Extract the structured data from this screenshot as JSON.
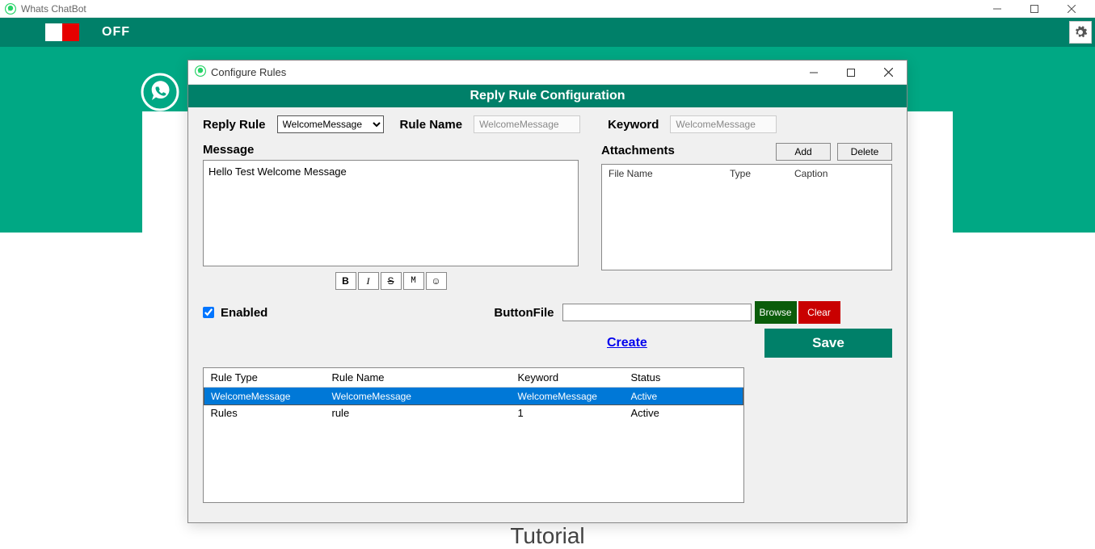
{
  "outer_title": "Whats ChatBot",
  "toggle_label": "OFF",
  "dialog": {
    "title": "Configure Rules",
    "header": "Reply Rule Configuration",
    "reply_rule_lbl": "Reply Rule",
    "reply_rule_value": "WelcomeMessage",
    "rule_name_lbl": "Rule Name",
    "rule_name_value": "WelcomeMessage",
    "keyword_lbl": "Keyword",
    "keyword_value": "WelcomeMessage",
    "message_lbl": "Message",
    "message_value": "Hello Test Welcome Message",
    "attachments_lbl": "Attachments",
    "add_btn": "Add",
    "delete_btn": "Delete",
    "att_cols": {
      "c1": "File Name",
      "c2": "Type",
      "c3": "Caption"
    },
    "fmt": {
      "b": "B",
      "i": "I",
      "s": "S",
      "m": "M",
      "e": "☺"
    },
    "enabled_lbl": "Enabled",
    "enabled_checked": true,
    "buttonfile_lbl": "ButtonFile",
    "browse_btn": "Browse",
    "clear_btn": "Clear",
    "create_link": "Create",
    "save_btn": "Save",
    "grid_cols": {
      "c1": "Rule Type",
      "c2": "Rule Name",
      "c3": "Keyword",
      "c4": "Status"
    },
    "grid_rows": [
      {
        "type": "WelcomeMessage",
        "name": "WelcomeMessage",
        "keyword": "WelcomeMessage",
        "status": "Active",
        "selected": true
      },
      {
        "type": "Rules",
        "name": "rule",
        "keyword": "1",
        "status": "Active",
        "selected": false
      }
    ]
  },
  "tutorial": "Tutorial"
}
